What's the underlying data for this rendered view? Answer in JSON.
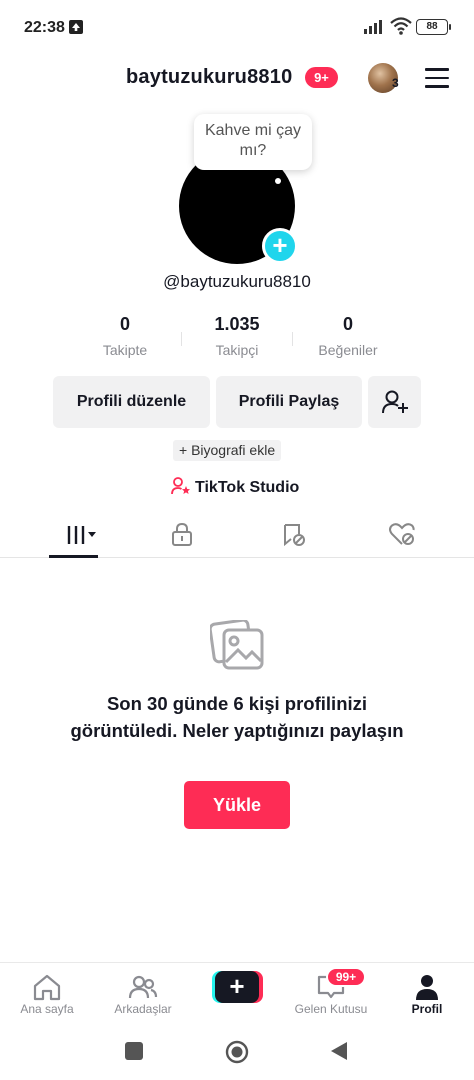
{
  "status_bar": {
    "time": "22:38",
    "battery": "88"
  },
  "header": {
    "username": "baytuzukuru8810",
    "notif_badge": "9+",
    "avatar_count": "3"
  },
  "profile": {
    "note": "Kahve mi çay mı?",
    "handle": "@baytuzukuru8810",
    "stats": [
      {
        "value": "0",
        "label": "Takipte"
      },
      {
        "value": "1.035",
        "label": "Takipçi"
      },
      {
        "value": "0",
        "label": "Beğeniler"
      }
    ],
    "edit_label": "Profili düzenle",
    "share_label": "Profili Paylaş",
    "bio_label": "+ Biyografi ekle",
    "studio_label": "TikTok Studio"
  },
  "tabs": [
    {
      "icon": "grid-icon",
      "active": true
    },
    {
      "icon": "lock-icon",
      "active": false
    },
    {
      "icon": "repost-icon",
      "active": false
    },
    {
      "icon": "liked-icon",
      "active": false
    }
  ],
  "empty_state": {
    "text": "Son 30 günde 6 kişi profilinizi görüntüledi. Neler yaptığınızı paylaşın",
    "upload_label": "Yükle"
  },
  "bottom_nav": {
    "home": "Ana sayfa",
    "friends": "Arkadaşlar",
    "inbox": "Gelen Kutusu",
    "inbox_badge": "99+",
    "profile": "Profil"
  },
  "colors": {
    "accent": "#fe2c55",
    "cyan": "#20d5ec",
    "text": "#161823",
    "muted": "#8a8b91"
  }
}
